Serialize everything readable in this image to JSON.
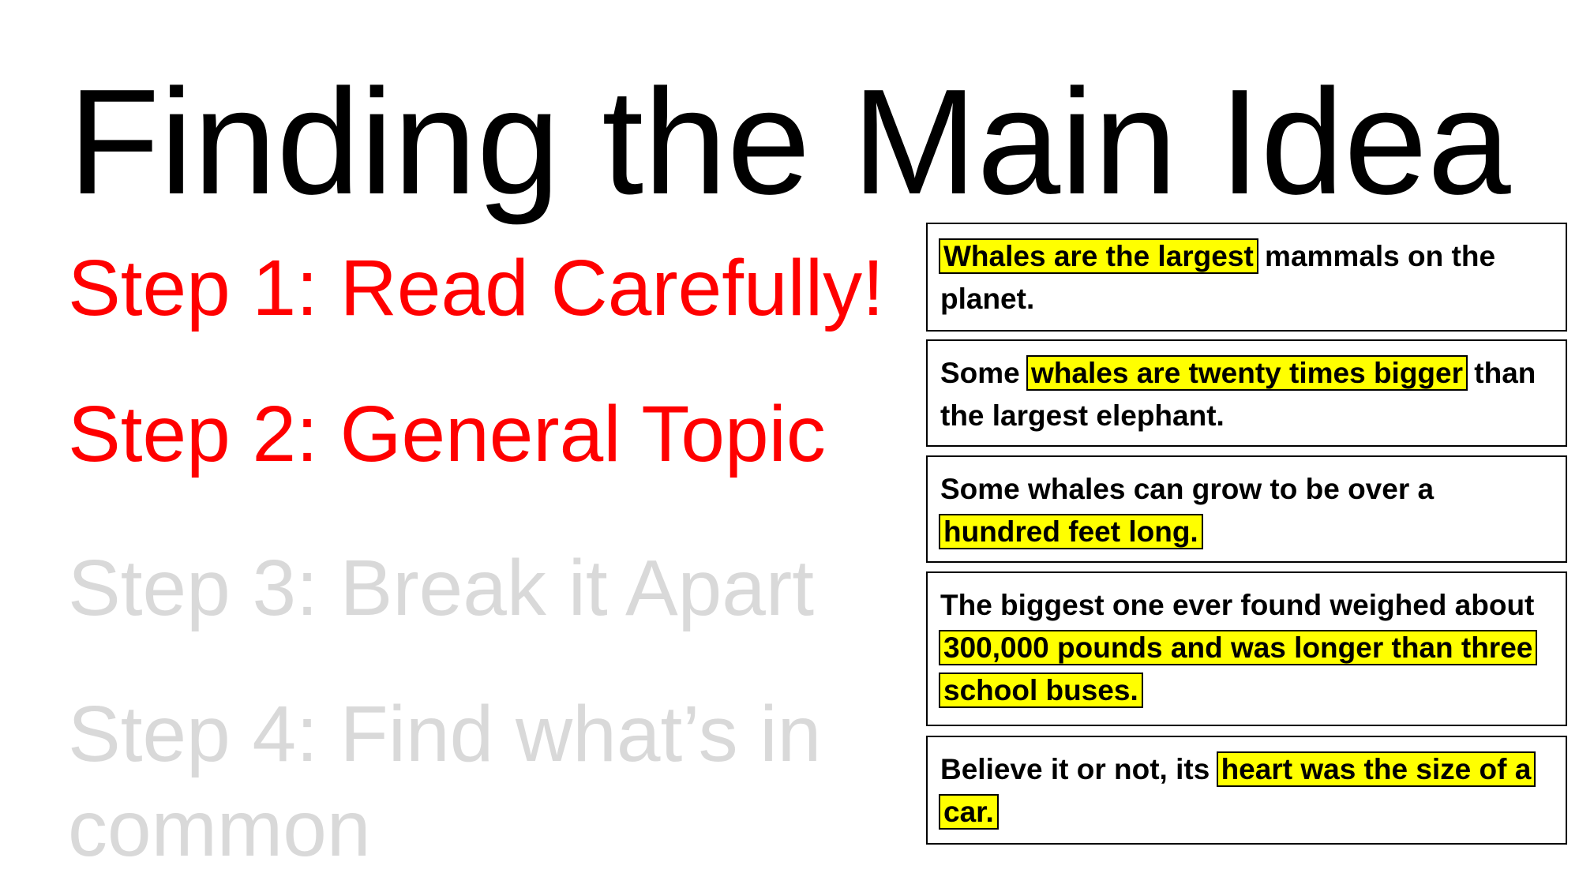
{
  "title": "Finding the Main Idea",
  "colors": {
    "active_step": "#ff0000",
    "inactive_step": "#d9d9d9",
    "highlight": "#ffff00",
    "text": "#000000"
  },
  "steps": [
    {
      "label": "Step 1: Read Carefully!",
      "state": "active"
    },
    {
      "label": "Step 2: General Topic",
      "state": "active"
    },
    {
      "label": "Step 3: Break it Apart",
      "state": "inactive"
    },
    {
      "label": "Step 4: Find what’s in common",
      "state": "inactive"
    }
  ],
  "fact_boxes": [
    {
      "before": "",
      "highlight": "Whales are the largest",
      "after": " mammals on the planet."
    },
    {
      "before": "Some ",
      "highlight": "whales are twenty times bigger",
      "after": " than the largest elephant."
    },
    {
      "before": "Some whales can grow to be over a ",
      "highlight": "hundred feet long.",
      "after": ""
    },
    {
      "before": "The biggest one ever found weighed about ",
      "highlight": "300,000 pounds and was longer than three school buses.",
      "after": ""
    },
    {
      "before": "Believe it or not, its ",
      "highlight": "heart was the size of a car.",
      "after": ""
    }
  ]
}
